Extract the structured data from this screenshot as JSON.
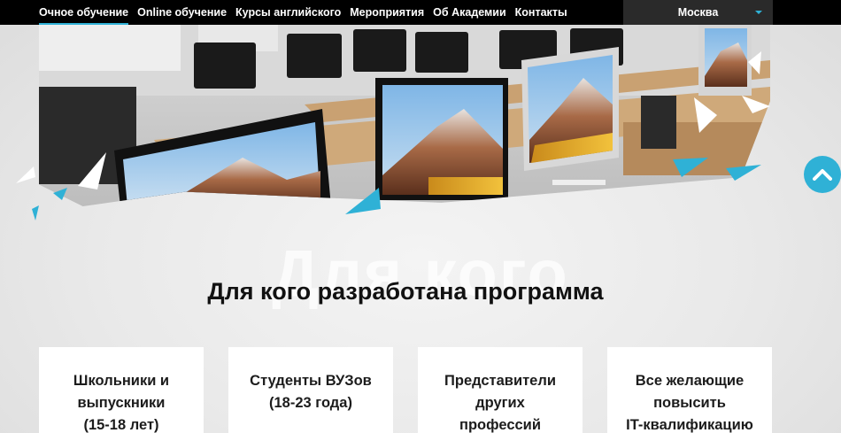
{
  "nav": {
    "items": [
      {
        "label": "Очное обучение",
        "active": true
      },
      {
        "label": "Online обучение",
        "active": false
      },
      {
        "label": "Курсы английского",
        "active": false
      },
      {
        "label": "Мероприятия",
        "active": false
      },
      {
        "label": "Об Академии",
        "active": false
      },
      {
        "label": "Контакты",
        "active": false
      }
    ],
    "city": "Москва"
  },
  "section": {
    "watermark": "Для кого",
    "title": "Для кого разработана программа"
  },
  "cards": [
    {
      "text": "Школьники и\nвыпускники\n(15-18 лет)"
    },
    {
      "text": "Студенты ВУЗов\n(18-23 года)"
    },
    {
      "text": "Представители\nдругих\nпрофессий"
    },
    {
      "text": "Все желающие\nповысить\nIT-квалификацию"
    }
  ],
  "colors": {
    "accent": "#2fb1d6",
    "topbar": "#000000",
    "city_bg": "#2a2a2a",
    "card_bg": "#ffffff"
  },
  "icons": {
    "scroll_up": "chevron-up-icon",
    "city_dropdown": "caret-down-icon"
  }
}
